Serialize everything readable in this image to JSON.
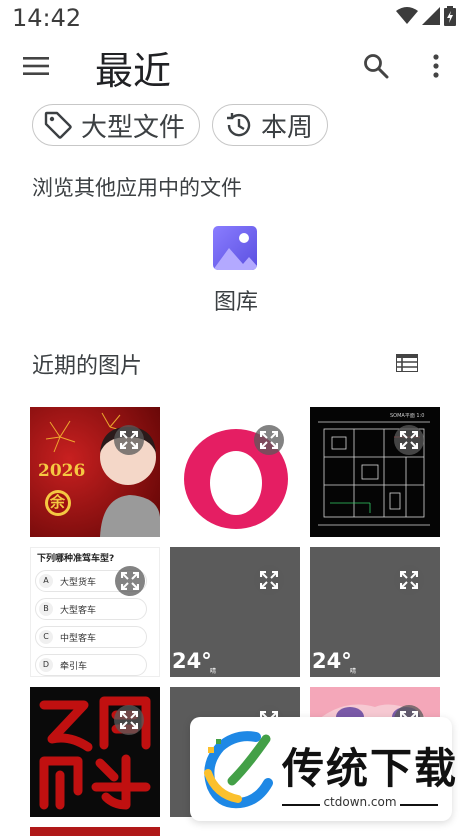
{
  "status_bar": {
    "time": "14:42"
  },
  "toolbar": {
    "title": "最近"
  },
  "filters": [
    {
      "label": "大型文件",
      "icon": "tag-icon"
    },
    {
      "label": "本周",
      "icon": "history-icon"
    }
  ],
  "browse": {
    "heading": "浏览其他应用中的文件",
    "apps": [
      {
        "label": "图库",
        "icon": "gallery-icon"
      }
    ]
  },
  "recent": {
    "heading": "近期的图片",
    "quiz": {
      "question": "下列哪种准驾车型?",
      "options": [
        {
          "key": "A",
          "text": "大型货车"
        },
        {
          "key": "B",
          "text": "大型客车"
        },
        {
          "key": "C",
          "text": "中型客车"
        },
        {
          "key": "D",
          "text": "牵引车"
        }
      ]
    },
    "year_text": "2026",
    "fu_text": "余",
    "temp_1": "24°",
    "temp_2": "24°",
    "temp_sub": "晴",
    "cad_title": "SOMA平面 1:0"
  },
  "watermark": {
    "title": "传统下载",
    "url": "ctdown.com"
  },
  "colors": {
    "accent": "#6c63ff",
    "pink": "#e91e63",
    "red_bg": "#8b0000"
  }
}
